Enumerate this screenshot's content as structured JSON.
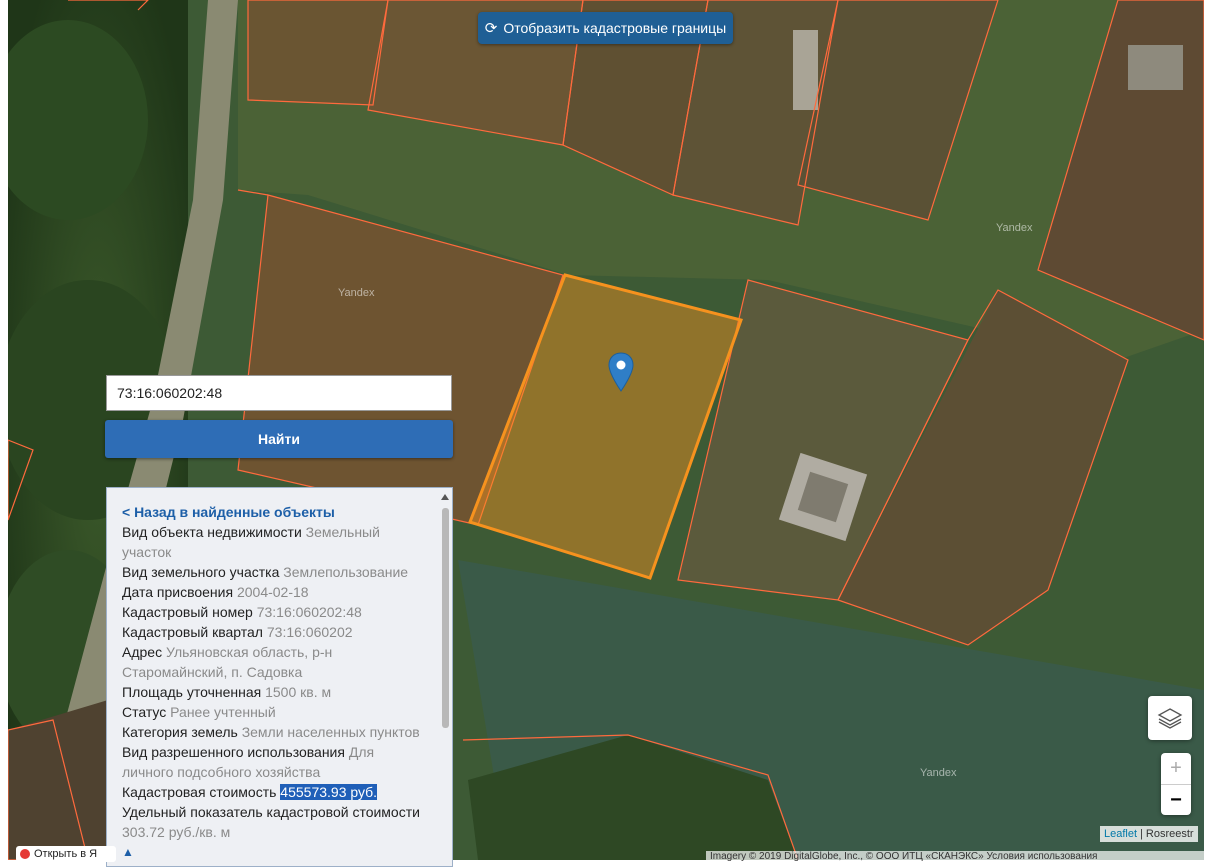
{
  "top_button": {
    "icon": "refresh-icon",
    "label": "Отобразить кадастровые границы"
  },
  "watermarks": [
    "Yandex",
    "Yandex",
    "Yandex"
  ],
  "search": {
    "value": "73:16:060202:48",
    "button_label": "Найти"
  },
  "panel": {
    "back_link": "< Назад в найденные объекты",
    "fields": [
      {
        "key": "Вид объекта недвижимости",
        "value": "Земельный участок"
      },
      {
        "key": "Вид земельного участка",
        "value": "Землепользование"
      },
      {
        "key": "Дата присвоения",
        "value": "2004-02-18"
      },
      {
        "key": "Кадастровый номер",
        "value": "73:16:060202:48"
      },
      {
        "key": "Кадастровый квартал",
        "value": "73:16:060202"
      },
      {
        "key": "Адрес",
        "value": "Ульяновская область, р-н Старомайнский, п. Садовка"
      },
      {
        "key": "Площадь уточненная",
        "value": "1500 кв. м"
      },
      {
        "key": "Статус",
        "value": "Ранее учтенный"
      },
      {
        "key": "Категория земель",
        "value": "Земли населенных пунктов"
      },
      {
        "key": "Вид разрешенного использования",
        "value": "Для личного подсобного хозяйства"
      },
      {
        "key": "Кадастровая стоимость",
        "value": "455573.93 руб."
      },
      {
        "key": "Удельный показатель кадастровой стоимости",
        "value": "303.72 руб./кв. м"
      }
    ],
    "scroll_top_glyph": "▲"
  },
  "controls": {
    "zoom_in": "+",
    "zoom_out": "−",
    "layers_icon": "layers-icon"
  },
  "attribution": {
    "leaflet": "Leaflet",
    "separator": "|",
    "provider": "Rosreestr"
  },
  "imagery_credit": "Imagery © 2019 DigitalGlobe, Inc., © ООО ИТЦ «СКАНЭКС» Условия использования",
  "open_badge": "Открыть в Я",
  "colors": {
    "parcel_border": "#ff6a3d",
    "selected_parcel": "#f6921e",
    "button_blue": "#2e6db6"
  }
}
